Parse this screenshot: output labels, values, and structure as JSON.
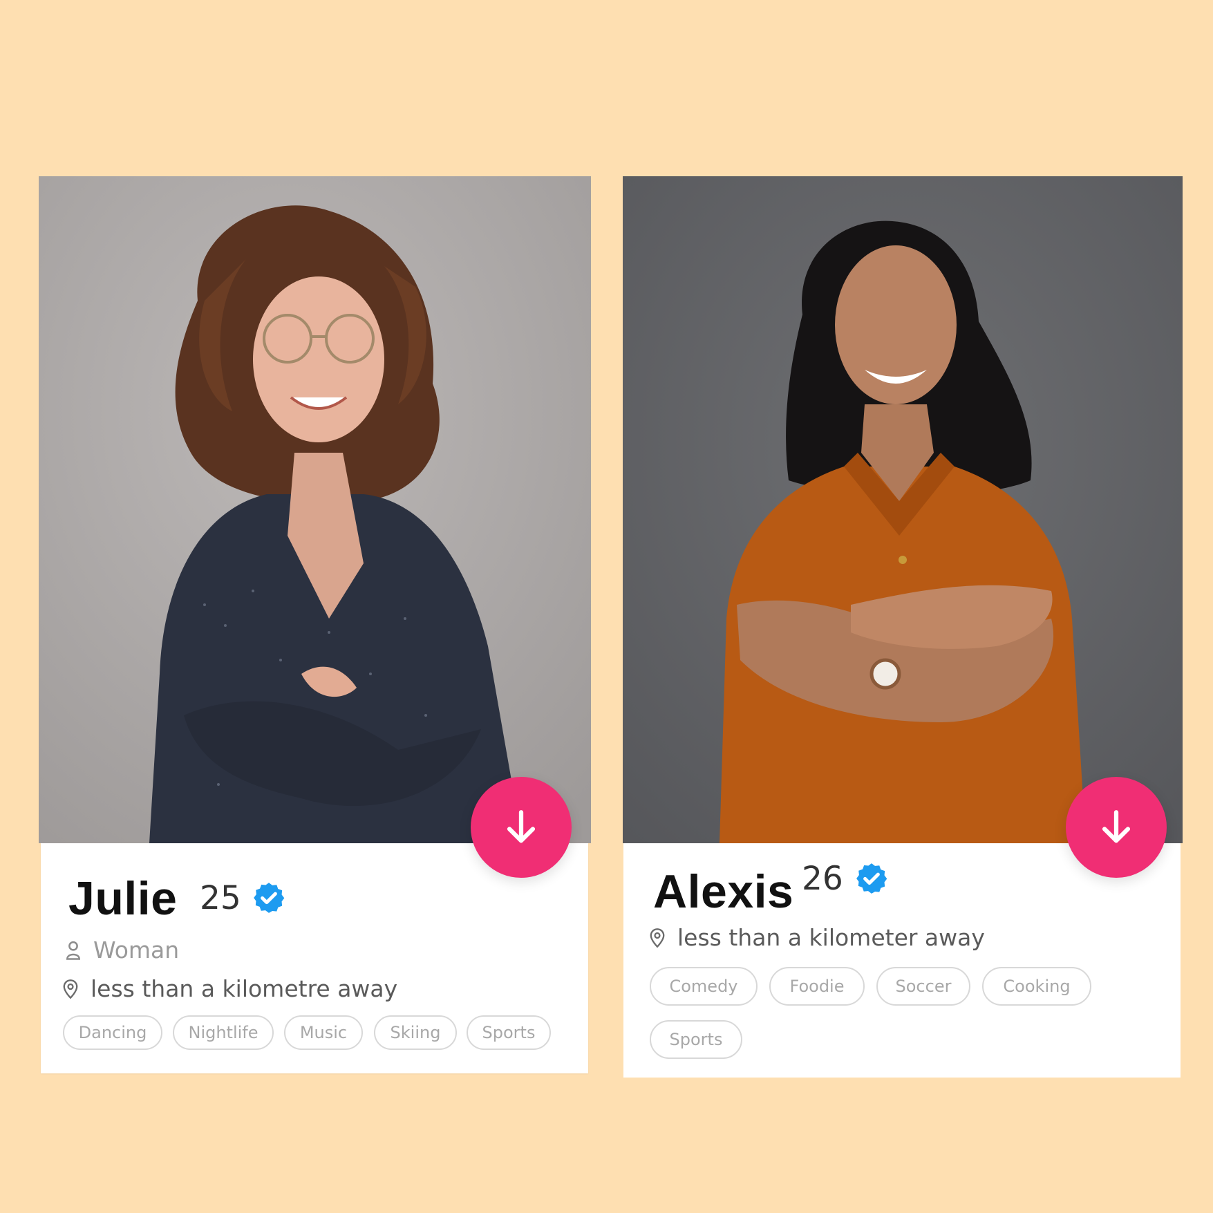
{
  "profiles": [
    {
      "name": "Julie",
      "age": "25",
      "gender": "Woman",
      "distance": "less than a kilometre away",
      "interests": [
        "Dancing",
        "Nightlife",
        "Music",
        "Skiing",
        "Sports"
      ]
    },
    {
      "name": "Alexis",
      "age": "26",
      "distance": "less than a kilometer away",
      "interests": [
        "Comedy",
        "Foodie",
        "Soccer",
        "Cooking",
        "Sports"
      ]
    }
  ],
  "colors": {
    "background": "#FEDFB1",
    "accent": "#F02E74",
    "verified": "#1D9BF0"
  },
  "icons": {
    "expand": "arrow-down-icon",
    "verified": "verified-badge-icon",
    "gender": "person-icon",
    "location": "location-pin-icon"
  }
}
